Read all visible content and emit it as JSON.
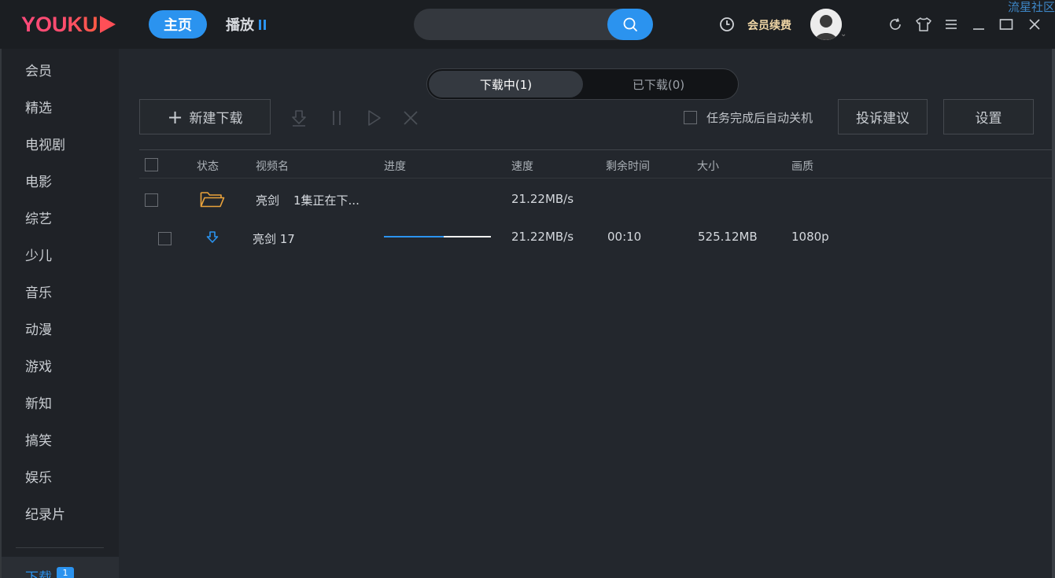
{
  "app": {
    "logo_text": "YOUKU",
    "watermark": "流星社区",
    "brand_color": "#2b93ef",
    "logo_color": "#ff4d6d"
  },
  "header": {
    "nav_home": "主页",
    "nav_play": "播放",
    "search_placeholder": "",
    "vip_renew": "会员续费"
  },
  "sidebar": {
    "items": [
      {
        "label": "会员"
      },
      {
        "label": "精选"
      },
      {
        "label": "电视剧"
      },
      {
        "label": "电影"
      },
      {
        "label": "综艺"
      },
      {
        "label": "少儿"
      },
      {
        "label": "音乐"
      },
      {
        "label": "动漫"
      },
      {
        "label": "游戏"
      },
      {
        "label": "新知"
      },
      {
        "label": "搞笑"
      },
      {
        "label": "娱乐"
      },
      {
        "label": "纪录片"
      }
    ],
    "download": {
      "label": "下载",
      "badge": "1"
    }
  },
  "main": {
    "tabs": [
      {
        "label": "下载中(1)",
        "active": true
      },
      {
        "label": "已下载(0)",
        "active": false
      }
    ],
    "toolbar": {
      "new_download": "新建下载",
      "auto_shutdown": "任务完成后自动关机",
      "feedback": "投诉建议",
      "settings": "设置"
    },
    "table": {
      "headers": {
        "status": "状态",
        "name": "视频名",
        "progress": "进度",
        "speed": "速度",
        "remaining": "剩余时间",
        "size": "大小",
        "quality": "画质"
      },
      "group_row": {
        "title": "亮剑",
        "status_text": "1集正在下...",
        "speed": "21.22MB/s"
      },
      "item_row": {
        "name": "亮剑 17",
        "progress": 0.56,
        "speed": "21.22MB/s",
        "remaining": "00:10",
        "size": "525.12MB",
        "quality": "1080p"
      }
    }
  }
}
